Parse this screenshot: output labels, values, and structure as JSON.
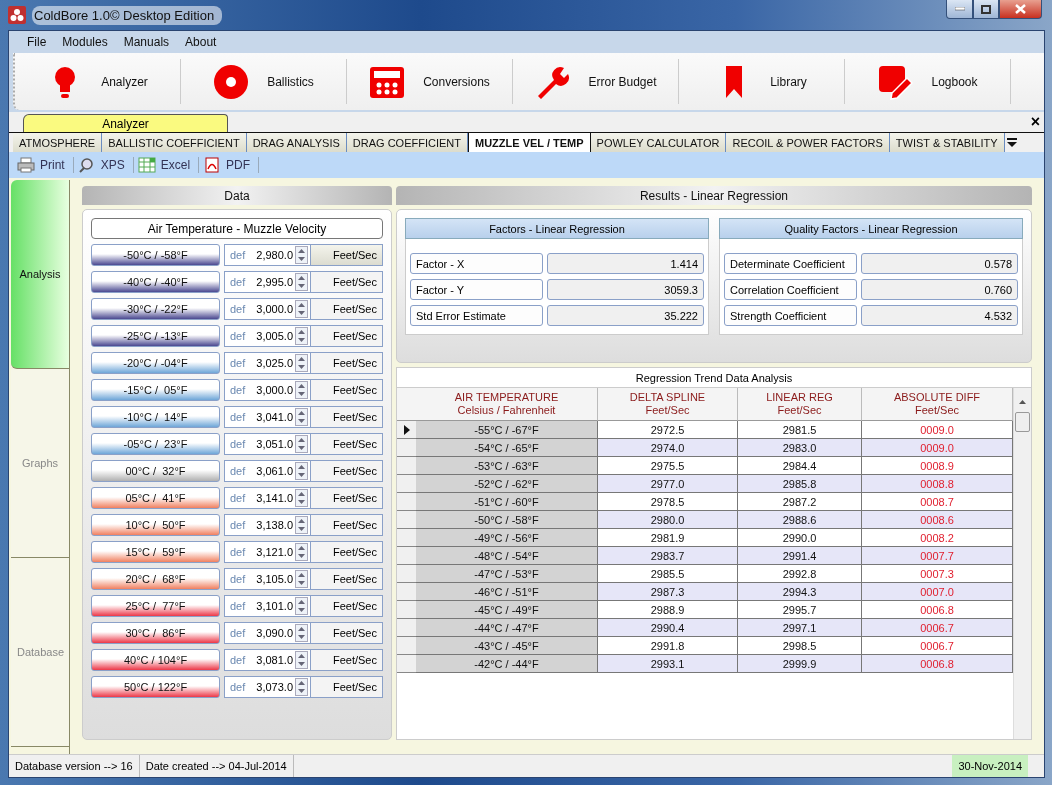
{
  "window": {
    "title": "ColdBore 1.0© Desktop Edition"
  },
  "menu": [
    "File",
    "Modules",
    "Manuals",
    "About"
  ],
  "modules": [
    {
      "label": "Analyzer",
      "kind": "bulb"
    },
    {
      "label": "Ballistics",
      "kind": "target"
    },
    {
      "label": "Conversions",
      "kind": "calculator"
    },
    {
      "label": "Error Budget",
      "kind": "wrench"
    },
    {
      "label": "Library",
      "kind": "bookmark"
    },
    {
      "label": "Logbook",
      "kind": "edit"
    }
  ],
  "document_tab": {
    "label": "Analyzer",
    "close": "×"
  },
  "tabs": [
    {
      "label": "ATMOSPHERE",
      "selected": false
    },
    {
      "label": "BALLISTIC COEFFICIENT",
      "selected": false
    },
    {
      "label": "DRAG ANALYSIS",
      "selected": false
    },
    {
      "label": "DRAG COEFFICIENT",
      "selected": false
    },
    {
      "label": "MUZZLE VEL / TEMP",
      "selected": true
    },
    {
      "label": "POWLEY CALCULATOR",
      "selected": false
    },
    {
      "label": "RECOIL & POWER FACTORS",
      "selected": false
    },
    {
      "label": "TWIST & STABILITY",
      "selected": false
    }
  ],
  "export": [
    {
      "label": "Print",
      "kind": "printer"
    },
    {
      "label": "XPS",
      "kind": "magnifier"
    },
    {
      "label": "Excel",
      "kind": "grid"
    },
    {
      "label": "PDF",
      "kind": "pdf"
    }
  ],
  "side_tabs": [
    {
      "label": "Analysis",
      "selected": true
    },
    {
      "label": "Graphs",
      "selected": false
    },
    {
      "label": "Database",
      "selected": false
    }
  ],
  "data_panel": {
    "title": "Data",
    "subtitle": "Air Temperature - Muzzle Velocity",
    "rows": [
      {
        "temp": "-50°C / -58°F",
        "kind": "cold",
        "def": "def",
        "value": "2,980.0",
        "unit": "Feet/Sec"
      },
      {
        "temp": "-40°C / -40°F",
        "kind": "cold",
        "def": "def",
        "value": "2,995.0",
        "unit": "Feet/Sec"
      },
      {
        "temp": "-30°C / -22°F",
        "kind": "cold",
        "def": "def",
        "value": "3,000.0",
        "unit": "Feet/Sec"
      },
      {
        "temp": "-25°C / -13°F",
        "kind": "cold",
        "def": "def",
        "value": "3,005.0",
        "unit": "Feet/Sec"
      },
      {
        "temp": "-20°C / -04°F",
        "kind": "cool",
        "def": "def",
        "value": "3,025.0",
        "unit": "Feet/Sec"
      },
      {
        "temp": "-15°C /  05°F",
        "kind": "cool",
        "def": "def",
        "value": "3,000.0",
        "unit": "Feet/Sec"
      },
      {
        "temp": "-10°C /  14°F",
        "kind": "cool",
        "def": "def",
        "value": "3,041.0",
        "unit": "Feet/Sec"
      },
      {
        "temp": "-05°C /  23°F",
        "kind": "cool",
        "def": "def",
        "value": "3,051.0",
        "unit": "Feet/Sec"
      },
      {
        "temp": "00°C /  32°F",
        "kind": "neutral",
        "def": "def",
        "value": "3,061.0",
        "unit": "Feet/Sec"
      },
      {
        "temp": "05°C /  41°F",
        "kind": "warm",
        "def": "def",
        "value": "3,141.0",
        "unit": "Feet/Sec"
      },
      {
        "temp": "10°C /  50°F",
        "kind": "warm",
        "def": "def",
        "value": "3,138.0",
        "unit": "Feet/Sec"
      },
      {
        "temp": "15°C /  59°F",
        "kind": "warm",
        "def": "def",
        "value": "3,121.0",
        "unit": "Feet/Sec"
      },
      {
        "temp": "20°C /  68°F",
        "kind": "warm",
        "def": "def",
        "value": "3,105.0",
        "unit": "Feet/Sec"
      },
      {
        "temp": "25°C /  77°F",
        "kind": "hot",
        "def": "def",
        "value": "3,101.0",
        "unit": "Feet/Sec"
      },
      {
        "temp": "30°C /  86°F",
        "kind": "hot",
        "def": "def",
        "value": "3,090.0",
        "unit": "Feet/Sec"
      },
      {
        "temp": "40°C / 104°F",
        "kind": "hot",
        "def": "def",
        "value": "3,081.0",
        "unit": "Feet/Sec"
      },
      {
        "temp": "50°C / 122°F",
        "kind": "hot",
        "def": "def",
        "value": "3,073.0",
        "unit": "Feet/Sec"
      }
    ]
  },
  "results": {
    "title": "Results - Linear Regression",
    "groups": [
      {
        "title": "Factors - Linear Regression",
        "fields": [
          {
            "label": "Factor - X",
            "value": "1.414"
          },
          {
            "label": "Factor - Y",
            "value": "3059.3"
          },
          {
            "label": "Std Error Estimate",
            "value": "35.222"
          }
        ]
      },
      {
        "title": "Quality Factors - Linear Regression",
        "fields": [
          {
            "label": "Determinate Coefficient",
            "value": "0.578"
          },
          {
            "label": "Correlation Coefficient",
            "value": "0.760"
          },
          {
            "label": "Strength Coefficient",
            "value": "4.532"
          }
        ]
      }
    ]
  },
  "table": {
    "title": "Regression Trend Data Analysis",
    "columns": [
      {
        "title": "AIR TEMPERATURE",
        "unit": "Celsius / Fahrenheit"
      },
      {
        "title": "DELTA SPLINE",
        "unit": "Feet/Sec"
      },
      {
        "title": "LINEAR REG",
        "unit": "Feet/Sec"
      },
      {
        "title": "ABSOLUTE DIFF",
        "unit": "Feet/Sec"
      }
    ],
    "rows": [
      {
        "selected": true,
        "cells": [
          "-55°C / -67°F",
          "2972.5",
          "2981.5",
          "0009.0"
        ]
      },
      {
        "selected": false,
        "cells": [
          "-54°C / -65°F",
          "2974.0",
          "2983.0",
          "0009.0"
        ]
      },
      {
        "selected": false,
        "cells": [
          "-53°C / -63°F",
          "2975.5",
          "2984.4",
          "0008.9"
        ]
      },
      {
        "selected": false,
        "cells": [
          "-52°C / -62°F",
          "2977.0",
          "2985.8",
          "0008.8"
        ]
      },
      {
        "selected": false,
        "cells": [
          "-51°C / -60°F",
          "2978.5",
          "2987.2",
          "0008.7"
        ]
      },
      {
        "selected": false,
        "cells": [
          "-50°C / -58°F",
          "2980.0",
          "2988.6",
          "0008.6"
        ]
      },
      {
        "selected": false,
        "cells": [
          "-49°C / -56°F",
          "2981.9",
          "2990.0",
          "0008.2"
        ]
      },
      {
        "selected": false,
        "cells": [
          "-48°C / -54°F",
          "2983.7",
          "2991.4",
          "0007.7"
        ]
      },
      {
        "selected": false,
        "cells": [
          "-47°C / -53°F",
          "2985.5",
          "2992.8",
          "0007.3"
        ]
      },
      {
        "selected": false,
        "cells": [
          "-46°C / -51°F",
          "2987.3",
          "2994.3",
          "0007.0"
        ]
      },
      {
        "selected": false,
        "cells": [
          "-45°C / -49°F",
          "2988.9",
          "2995.7",
          "0006.8"
        ]
      },
      {
        "selected": false,
        "cells": [
          "-44°C / -47°F",
          "2990.4",
          "2997.1",
          "0006.7"
        ]
      },
      {
        "selected": false,
        "cells": [
          "-43°C / -45°F",
          "2991.8",
          "2998.5",
          "0006.7"
        ]
      },
      {
        "selected": false,
        "cells": [
          "-42°C / -44°F",
          "2993.1",
          "2999.9",
          "0006.8"
        ]
      }
    ]
  },
  "status_bar": {
    "items": [
      "Database version --> 16",
      "Date created --> 04-Jul-2014"
    ],
    "date": "30-Nov-2014"
  }
}
